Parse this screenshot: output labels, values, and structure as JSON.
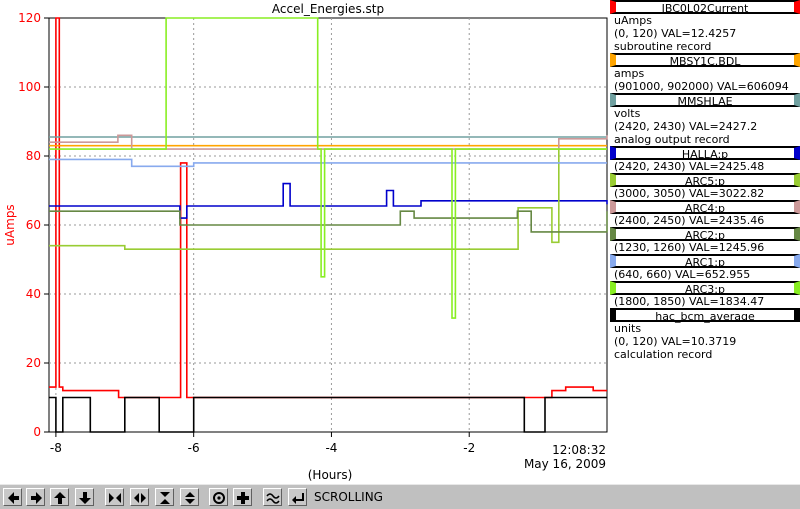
{
  "chart_data": {
    "type": "line",
    "title": "Accel_Energies.stp",
    "xlabel": "(Hours)",
    "ylabel": "uAmps",
    "xlim": [
      -8.1,
      0
    ],
    "ylim": [
      0,
      120
    ],
    "x_ticks": [
      -8,
      -6,
      -4,
      -2
    ],
    "x_tick_labels": [
      "-8",
      "-6",
      "-4",
      "-2"
    ],
    "y_ticks": [
      0,
      20,
      40,
      60,
      80,
      100,
      120
    ],
    "y_tick_labels": [
      "0",
      "20",
      "40",
      "60",
      "80",
      "100",
      "120"
    ],
    "end_time": "12:08:32",
    "end_date": "May 16, 2009",
    "grid": true,
    "legend_position": "right",
    "series": [
      {
        "name": "IBC0L02Current",
        "color": "#ff0000",
        "x": [
          -8.1,
          -8.05,
          -8.0,
          -7.95,
          -7.9,
          -7.1,
          -7.09,
          -7.0,
          -6.3,
          -6.2,
          -6.19,
          -6.1,
          -5.0,
          -3.0,
          -1.0,
          -0.8,
          -0.6,
          -0.2,
          0
        ],
        "y": [
          13,
          13,
          120,
          13,
          12,
          12,
          10,
          10,
          10,
          10,
          78,
          10,
          10,
          10,
          10,
          12,
          13,
          12,
          12
        ]
      },
      {
        "name": "MBSY1C.BDL",
        "color": "#ffa500",
        "x": [
          -8.1,
          0
        ],
        "y": [
          83,
          83
        ]
      },
      {
        "name": "MMSHLAE",
        "color": "#70a0a0",
        "x": [
          -8.1,
          0
        ],
        "y": [
          85.5,
          85.5
        ]
      },
      {
        "name": "HALLA:p",
        "color": "#0000cc",
        "x": [
          -8.1,
          -6.3,
          -6.2,
          -6.1,
          -5.2,
          -4.7,
          -4.6,
          -3.4,
          -3.2,
          -3.1,
          -2.9,
          -2.7,
          0
        ],
        "y": [
          65.5,
          65.5,
          62,
          65.5,
          65.5,
          72,
          65.5,
          65.5,
          70,
          65.5,
          65.5,
          67,
          66
        ]
      },
      {
        "name": "ARC5:p",
        "color": "#99cc33",
        "x": [
          -8.1,
          -7.1,
          -7.0,
          -1.3,
          -1.29,
          -1.1,
          -0.8,
          -0.7,
          0
        ],
        "y": [
          54,
          54,
          53,
          53,
          65,
          65,
          55,
          82,
          82
        ]
      },
      {
        "name": "ARC4:p",
        "color": "#cc9999",
        "x": [
          -8.1,
          -7.9,
          -7.1,
          -6.9,
          -1.2,
          -0.7,
          0
        ],
        "y": [
          84,
          84,
          86,
          82,
          82,
          85,
          86
        ]
      },
      {
        "name": "ARC2:p",
        "color": "#668844",
        "x": [
          -8.1,
          -6.3,
          -6.2,
          -3.0,
          -2.8,
          -1.3,
          -1.1,
          0
        ],
        "y": [
          64,
          64,
          60,
          64,
          62,
          64,
          58,
          64
        ]
      },
      {
        "name": "ARC1:p",
        "color": "#88aaee",
        "x": [
          -8.1,
          -7.1,
          -6.9,
          -6.0,
          -4.0,
          -2.0,
          -0.2,
          0
        ],
        "y": [
          79,
          79,
          77,
          78,
          78,
          78,
          78,
          78
        ]
      },
      {
        "name": "ARC3:p",
        "color": "#88ee22",
        "x": [
          -8.1,
          -6.5,
          -6.4,
          -4.2,
          -4.15,
          -4.1,
          -2.3,
          -2.25,
          -2.2,
          0
        ],
        "y": [
          82,
          82,
          120,
          82,
          45,
          82,
          82,
          33,
          82,
          82
        ]
      },
      {
        "name": "hac_bcm_average",
        "color": "#000000",
        "x": [
          -8.1,
          -8.0,
          -7.9,
          -7.5,
          -7.0,
          -6.5,
          -6.0,
          -5.0,
          -3.0,
          -1.3,
          -1.2,
          -0.9,
          0
        ],
        "y": [
          10,
          0,
          10,
          0,
          10,
          0,
          10,
          10,
          10,
          10,
          0,
          10,
          10
        ]
      }
    ]
  },
  "legend": [
    {
      "name": "IBC0L02Current",
      "color": "#ff0000",
      "lines": [
        "uAmps",
        "(0, 120) VAL=12.4257",
        "subroutine record"
      ]
    },
    {
      "name": "MBSY1C.BDL",
      "color": "#ffa500",
      "lines": [
        "amps",
        "(901000, 902000)  VAL=606094"
      ]
    },
    {
      "name": "MMSHLAE",
      "color": "#70a0a0",
      "lines": [
        "volts",
        "(2420, 2430)  VAL=2427.2",
        "analog output record"
      ]
    },
    {
      "name": "HALLA:p",
      "color": "#0000cc",
      "lines": [
        "(2420, 2430) VAL=2425.48"
      ]
    },
    {
      "name": "ARC5:p",
      "color": "#99cc33",
      "lines": [
        "(3000, 3050) VAL=3022.82"
      ]
    },
    {
      "name": "ARC4:p",
      "color": "#cc9999",
      "lines": [
        "(2400, 2450) VAL=2435.46"
      ]
    },
    {
      "name": "ARC2:p",
      "color": "#668844",
      "lines": [
        "(1230, 1260) VAL=1245.96"
      ]
    },
    {
      "name": "ARC1:p",
      "color": "#88aaee",
      "lines": [
        "(640, 660) VAL=652.955"
      ]
    },
    {
      "name": "ARC3:p",
      "color": "#88ee22",
      "lines": [
        "(1800, 1850) VAL=1834.47"
      ]
    },
    {
      "name": "hac_bcm_average",
      "color": "#000000",
      "lines": [
        "units",
        "(0, 120) VAL=10.3719",
        "calculation record"
      ]
    }
  ],
  "toolbar": {
    "buttons": [
      {
        "name": "scroll-left-icon"
      },
      {
        "name": "scroll-right-icon"
      },
      {
        "name": "scroll-up-icon"
      },
      {
        "name": "scroll-down-icon"
      },
      {
        "name": "zoom-in-horizontal-icon"
      },
      {
        "name": "zoom-out-horizontal-icon"
      },
      {
        "name": "zoom-in-vertical-icon"
      },
      {
        "name": "zoom-out-vertical-icon"
      },
      {
        "name": "auto-scale-icon"
      },
      {
        "name": "add-icon"
      },
      {
        "name": "waveform-icon"
      },
      {
        "name": "return-icon"
      }
    ],
    "mode": "SCROLLING"
  }
}
